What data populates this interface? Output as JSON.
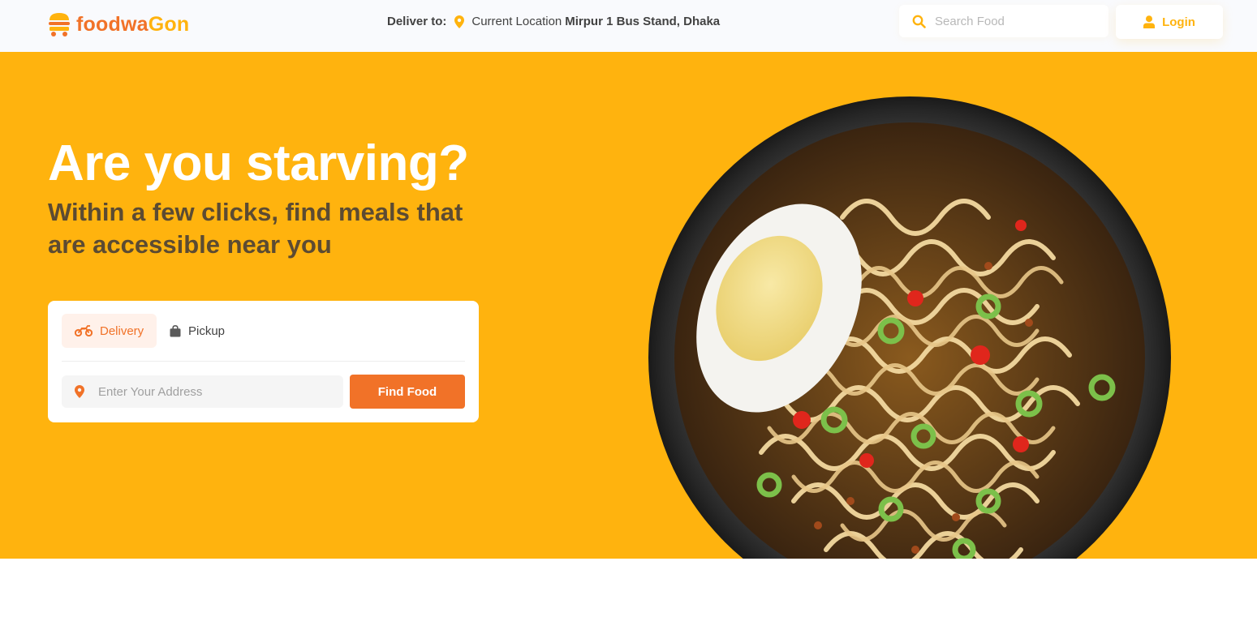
{
  "brand": {
    "name_part1": "foodwa",
    "name_part2": "Gon"
  },
  "header": {
    "deliver_label": "Deliver to:",
    "current_location_label": "Current Location",
    "address": "Mirpur 1 Bus Stand, Dhaka",
    "search_placeholder": "Search Food",
    "login_label": "Login"
  },
  "hero": {
    "title": "Are you starving?",
    "subtitle": "Within a few clicks, find meals that are accessible near you"
  },
  "order_card": {
    "tabs": [
      {
        "label": "Delivery",
        "icon": "motorbike-icon",
        "selected": true
      },
      {
        "label": "Pickup",
        "icon": "shopping-bag-icon",
        "selected": false
      }
    ],
    "address_placeholder": "Enter Your Address",
    "find_button": "Find Food"
  },
  "colors": {
    "primary_orange": "#f17228",
    "accent_yellow": "#ffb30e",
    "subtitle_text": "#5c4b32",
    "header_bg": "#f9fafd"
  }
}
